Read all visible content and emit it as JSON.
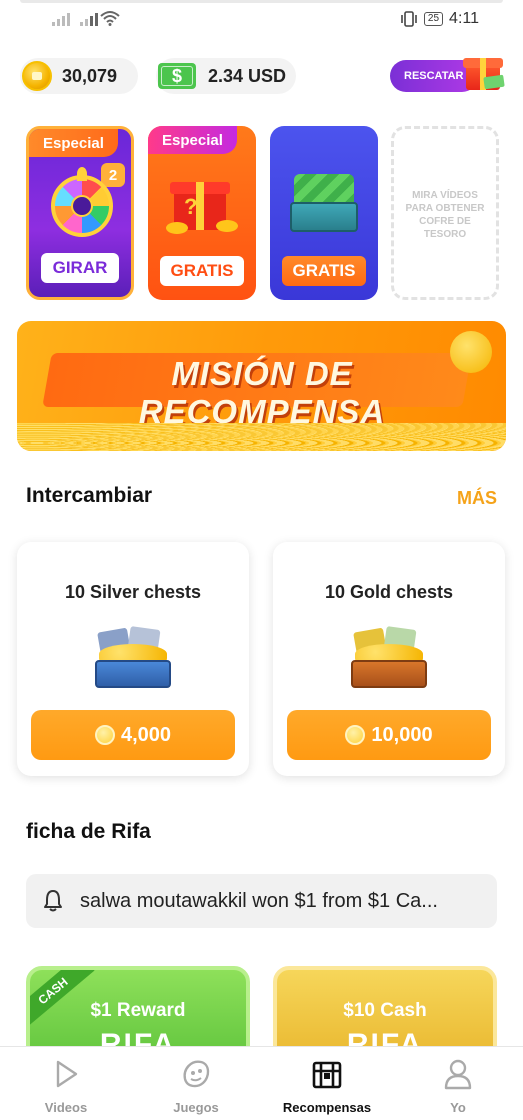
{
  "status_bar": {
    "time": "4:11",
    "battery": "25"
  },
  "balances": {
    "coins": "30,079",
    "cash": "2.34 USD"
  },
  "rescatar_label": "RESCATAR",
  "cards": [
    {
      "tag": "Especial",
      "badge": "2",
      "button": "GIRAR"
    },
    {
      "tag": "Especial",
      "button": "GRATIS"
    },
    {
      "button": "GRATIS"
    },
    {
      "empty_text": "MIRA VÍDEOS PARA OBTENER COFRE DE TESORO"
    }
  ],
  "banner_title": "MISIÓN DE RECOMPENSA",
  "exchange": {
    "title": "Intercambiar",
    "more": "MÁS",
    "items": [
      {
        "name": "10 Silver chests",
        "price": "4,000"
      },
      {
        "name": "10 Gold chests",
        "price": "10,000"
      }
    ]
  },
  "raffle": {
    "title": "ficha de Rifa",
    "ticker": "salwa moutawakkil won $1 from $1 Ca...",
    "cards": [
      {
        "tag": "CASH",
        "title": "$1 Reward",
        "big": "RIFA"
      },
      {
        "title": "$10 Cash",
        "big": "RIFA"
      }
    ]
  },
  "nav": [
    {
      "label": "Videos",
      "icon": "play-icon"
    },
    {
      "label": "Juegos",
      "icon": "games-icon"
    },
    {
      "label": "Recompensas",
      "icon": "treasure-chest-icon",
      "active": true
    },
    {
      "label": "Yo",
      "icon": "person-icon"
    }
  ]
}
